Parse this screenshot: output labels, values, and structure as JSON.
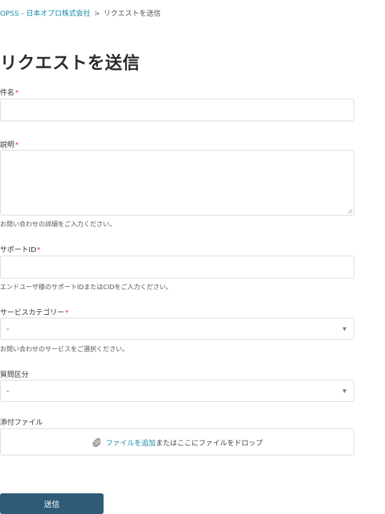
{
  "breadcrumb": {
    "home": "OPSS - 日本オプロ株式会社",
    "separator": ">",
    "current": "リクエストを送信"
  },
  "page": {
    "title": "リクエストを送信"
  },
  "required_mark": "*",
  "form": {
    "subject": {
      "label": "件名",
      "value": ""
    },
    "description": {
      "label": "説明",
      "value": "",
      "hint": "お問い合わせの詳細をご入力ください。"
    },
    "support_id": {
      "label": "サポートID",
      "value": "",
      "hint": "エンドユーザ様のサポートIDまたはCIDをご入力ください。"
    },
    "service_category": {
      "label": "サービスカテゴリー",
      "selected": "-",
      "hint": "お問い合わせのサービスをご選択ください。"
    },
    "question_type": {
      "label": "質問区分",
      "selected": "-"
    },
    "attachment": {
      "label": "添付ファイル",
      "add_link": "ファイルを追加",
      "drop_text": "またはここにファイルをドロップ",
      "icon": "paperclip-icon"
    }
  },
  "submit": {
    "label": "送信"
  },
  "colors": {
    "link": "#1a8aa8",
    "required": "#e0413c",
    "submit_bg": "#2f5b79"
  }
}
